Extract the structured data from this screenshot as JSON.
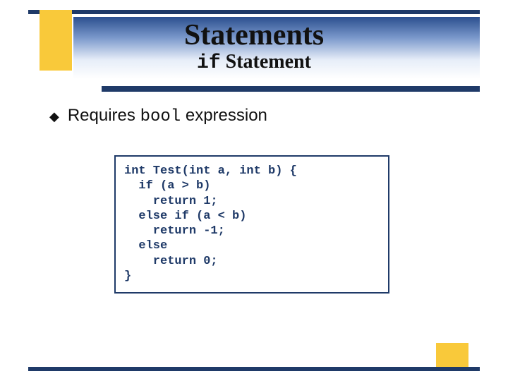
{
  "header": {
    "title": "Statements",
    "subtitle_kw": "if",
    "subtitle_rest": " Statement"
  },
  "bullets": [
    {
      "marker": "◆",
      "prefix": "Requires ",
      "kw": "bool",
      "suffix": " expression"
    }
  ],
  "code": "int Test(int a, int b) {\n  if (a > b)\n    return 1;\n  else if (a < b)\n    return -1;\n  else\n    return 0;\n}"
}
